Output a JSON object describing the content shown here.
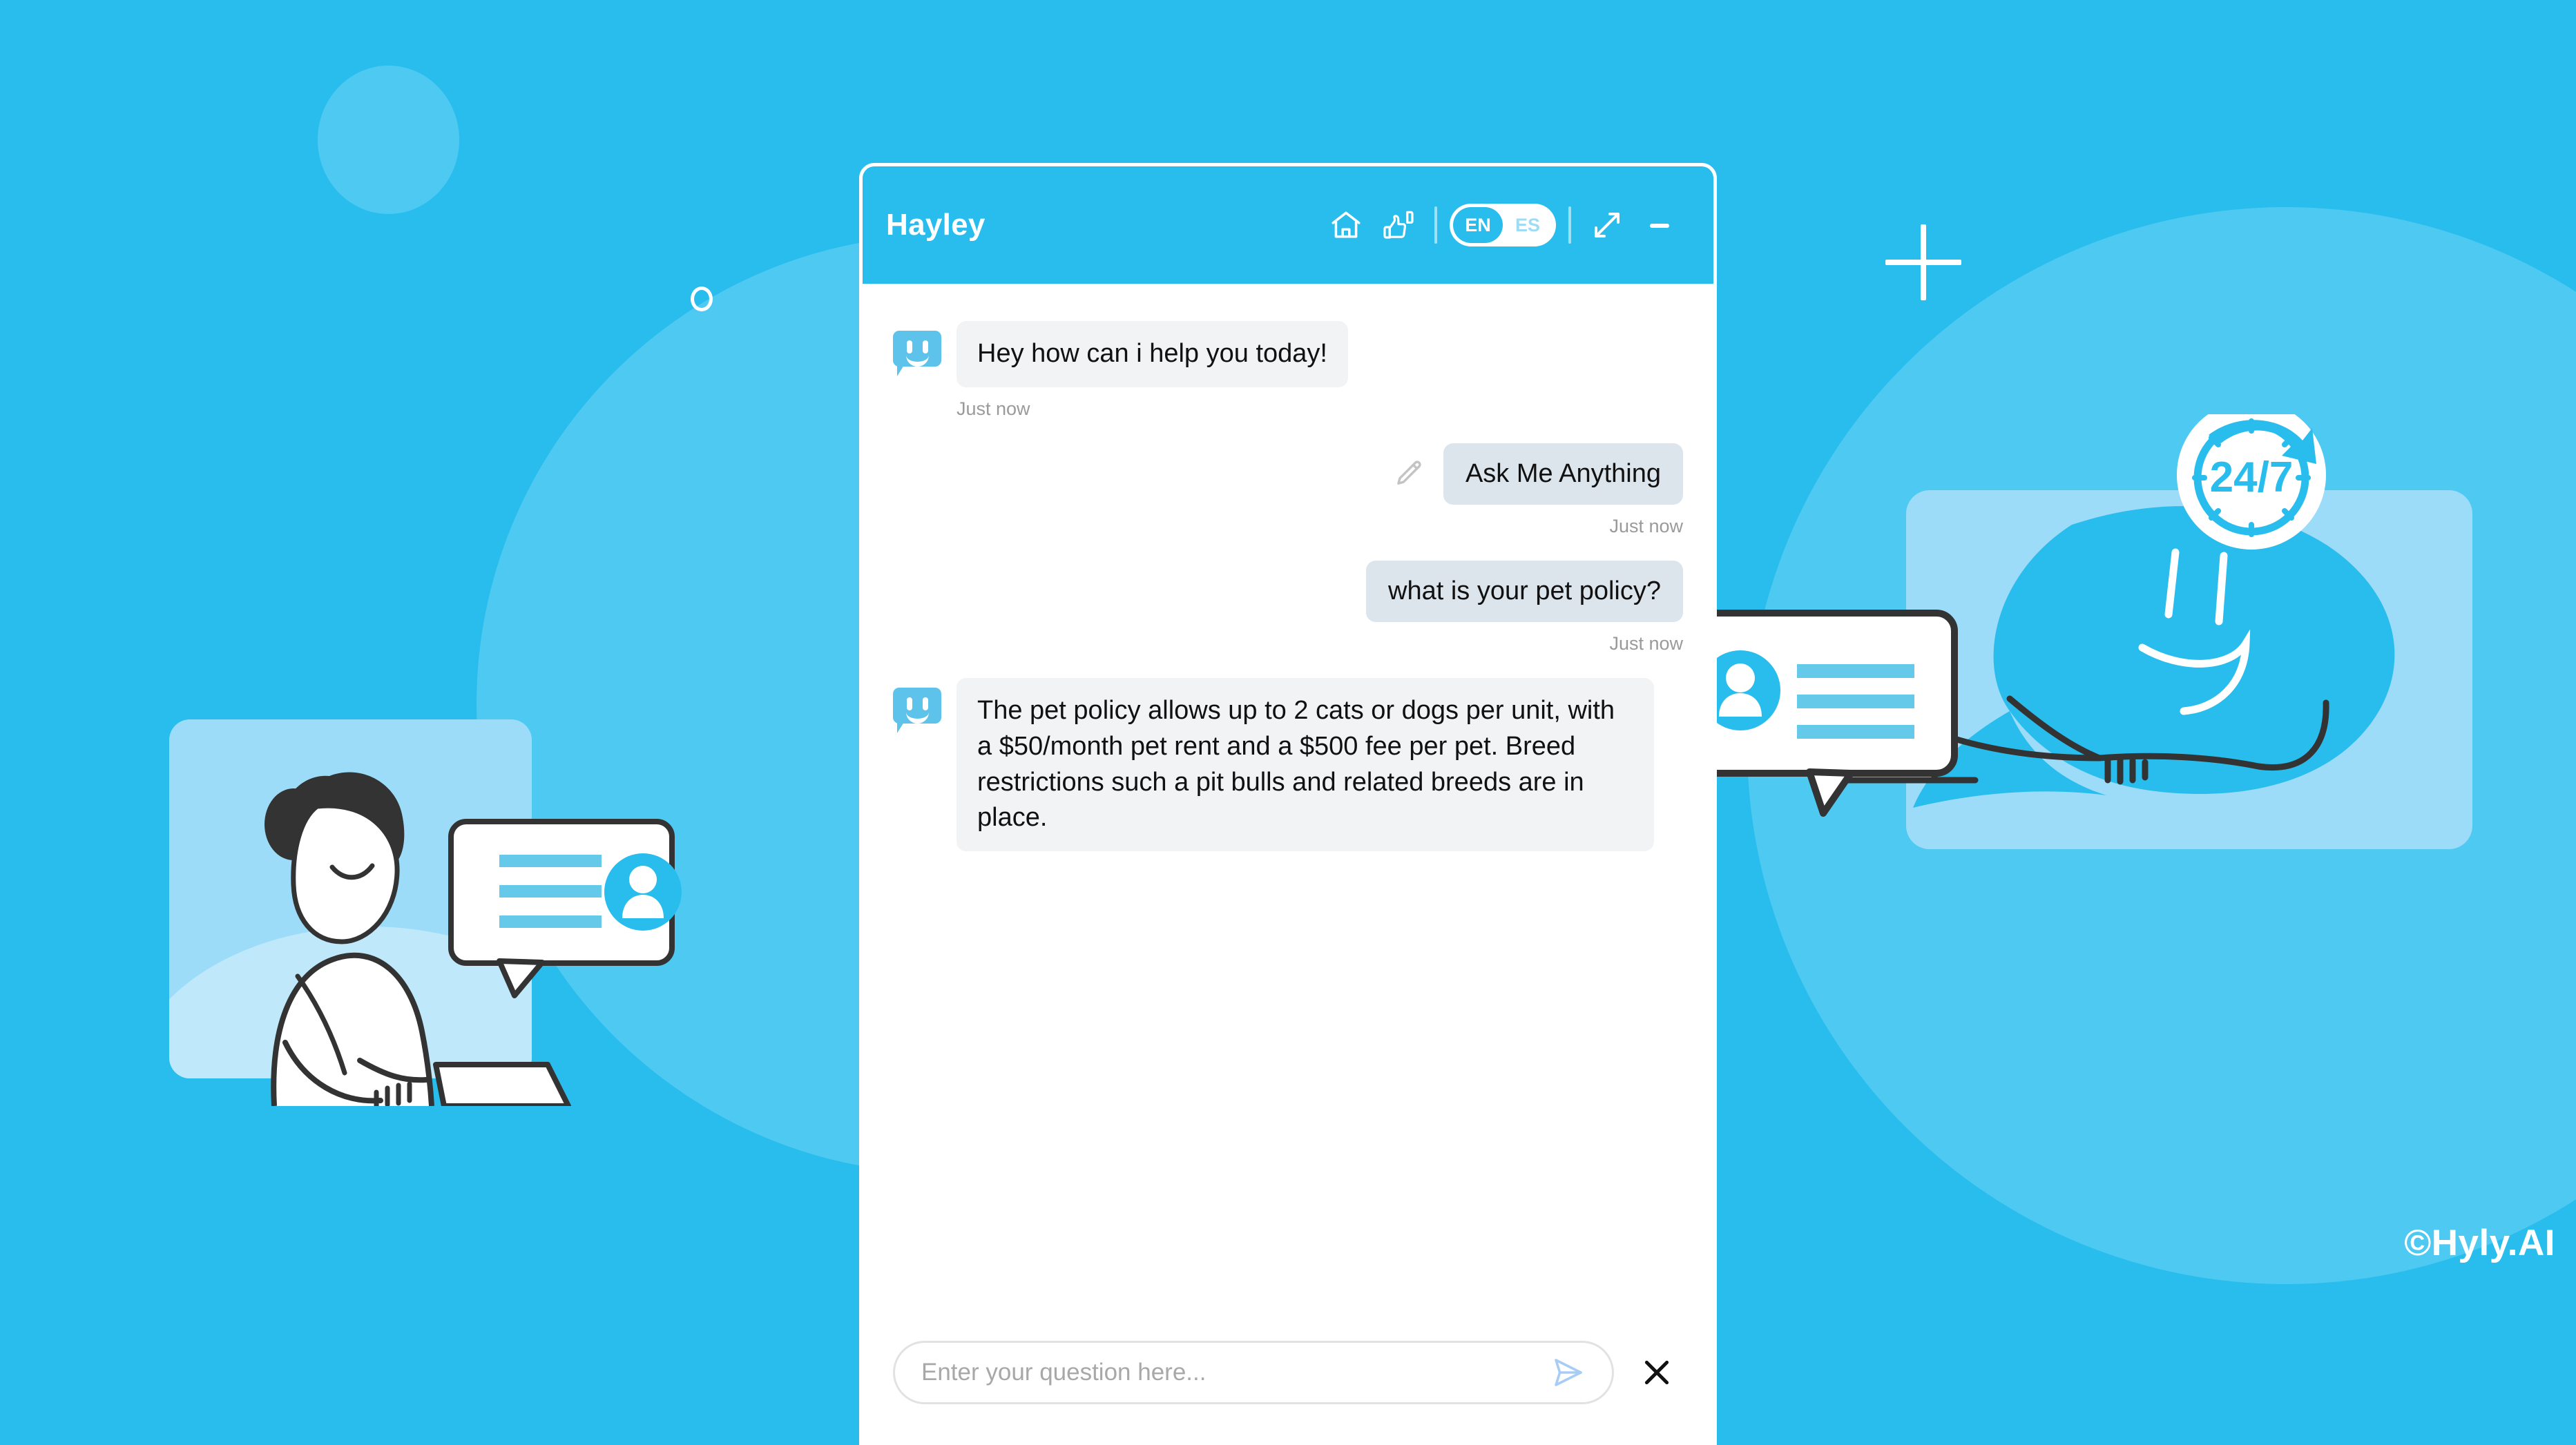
{
  "brand": {
    "copyright": "©Hyly.AI",
    "accent_color": "#29bdee",
    "accent_light": "#4ecaf2",
    "card_color": "#9ddcf8",
    "bot_bubble_color": "#f2f3f4",
    "user_bubble_color": "#dde5ec"
  },
  "chat": {
    "header": {
      "title": "Hayley",
      "icons": {
        "home": "home-icon",
        "feedback": "thumbs-up-down-icon",
        "expand": "expand-icon",
        "minimize": "minimize-icon"
      },
      "language_toggle": {
        "active": "EN",
        "inactive": "ES",
        "options": [
          "EN",
          "ES"
        ]
      }
    },
    "messages": [
      {
        "sender": "bot",
        "text": "Hey how can i help you today!",
        "timestamp": "Just now"
      },
      {
        "sender": "user",
        "text": "Ask Me Anything",
        "timestamp": "Just now",
        "editable": true
      },
      {
        "sender": "user",
        "text": "what is your pet policy?",
        "timestamp": "Just now",
        "editable": false
      },
      {
        "sender": "bot",
        "text": "The pet policy allows up to 2 cats or dogs per unit, with a $50/month pet rent and a $500 fee per pet. Breed restrictions such a pit bulls and related breeds are in place.",
        "timestamp": ""
      }
    ],
    "composer": {
      "placeholder": "Enter your question here...",
      "value": "",
      "send_icon": "send-icon",
      "close_icon": "close-icon"
    }
  },
  "decorations": {
    "clock_label": "24/7",
    "plus": "plus-icon",
    "ring": "circle-outline-icon"
  }
}
